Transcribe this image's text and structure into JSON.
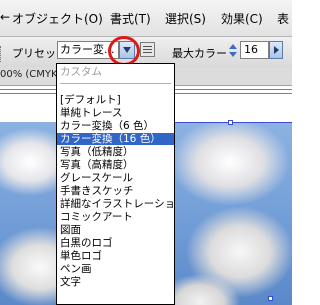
{
  "menubar": {
    "partial": "←",
    "items": [
      "オブジェクト(O)",
      "書式(T)",
      "選択(S)",
      "効果(C)",
      "表"
    ]
  },
  "options": {
    "preset_label": "プリセット：",
    "preset_value": "カラー変...",
    "max_colors_label": "最大カラー",
    "max_colors_value": "16"
  },
  "document": {
    "tab_text": "00% (CMYK"
  },
  "dropdown": {
    "items": [
      {
        "label": "カスタム",
        "state": "disabled"
      },
      {
        "label": "[デフォルト]",
        "state": "normal"
      },
      {
        "label": "単純トレース",
        "state": "normal"
      },
      {
        "label": "カラー変換（6 色）",
        "state": "normal"
      },
      {
        "label": "カラー変換（16 色）",
        "state": "selected"
      },
      {
        "label": "写真（低精度）",
        "state": "normal"
      },
      {
        "label": "写真（高精度）",
        "state": "normal"
      },
      {
        "label": "グレースケール",
        "state": "normal"
      },
      {
        "label": "手書きスケッチ",
        "state": "normal"
      },
      {
        "label": "詳細なイラストレーション",
        "state": "normal"
      },
      {
        "label": "コミックアート",
        "state": "normal"
      },
      {
        "label": "図面",
        "state": "normal"
      },
      {
        "label": "白黒のロゴ",
        "state": "normal"
      },
      {
        "label": "単色ロゴ",
        "state": "normal"
      },
      {
        "label": "ペン画",
        "state": "normal"
      },
      {
        "label": "文字",
        "state": "normal"
      }
    ]
  },
  "colors": {
    "selection_highlight": "#3165c6",
    "annotation_circle": "#e01818",
    "bounding_box": "#3a4bd8"
  }
}
